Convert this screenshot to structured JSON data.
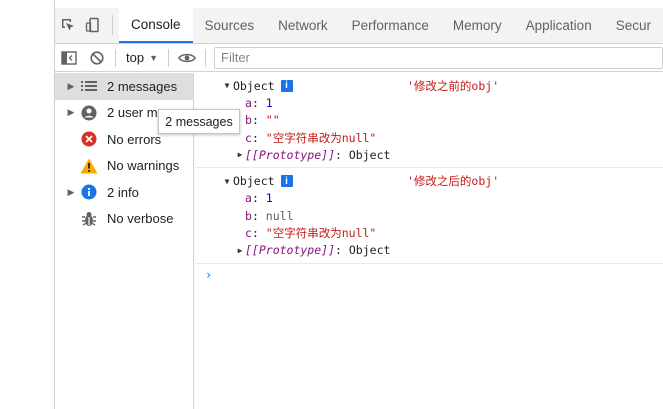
{
  "tabs": [
    {
      "label": "Console",
      "active": true
    },
    {
      "label": "Sources"
    },
    {
      "label": "Network"
    },
    {
      "label": "Performance"
    },
    {
      "label": "Memory"
    },
    {
      "label": "Application"
    },
    {
      "label": "Secur"
    }
  ],
  "toolbar": {
    "context": "top",
    "filter_placeholder": "Filter"
  },
  "sidebar": {
    "items": [
      {
        "label": "2 messages",
        "icon": "list-icon",
        "expandable": true,
        "selected": true
      },
      {
        "label": "2 user m",
        "icon": "user-icon",
        "expandable": true
      },
      {
        "label": "No errors",
        "icon": "error-icon",
        "expandable": false
      },
      {
        "label": "No warnings",
        "icon": "warning-icon",
        "expandable": false
      },
      {
        "label": "2 info",
        "icon": "info-icon",
        "expandable": true
      },
      {
        "label": "No verbose",
        "icon": "bug-icon",
        "expandable": false
      }
    ]
  },
  "tooltip": "2 messages",
  "messages": [
    {
      "object_label": "Object",
      "info_glyph": "i",
      "log_label": "'修改之前的obj'",
      "props": [
        {
          "key": "a",
          "value": "1",
          "type": "num"
        },
        {
          "key": "b",
          "value": "\"\"",
          "type": "str"
        },
        {
          "key": "c",
          "value": "\"空字符串改为null\"",
          "type": "str"
        }
      ],
      "prototype_key": "[[Prototype]]",
      "prototype_value": "Object"
    },
    {
      "object_label": "Object",
      "info_glyph": "i",
      "log_label": "'修改之后的obj'",
      "props": [
        {
          "key": "a",
          "value": "1",
          "type": "num"
        },
        {
          "key": "b",
          "value": "null",
          "type": "nul"
        },
        {
          "key": "c",
          "value": "\"空字符串改为null\"",
          "type": "str"
        }
      ],
      "prototype_key": "[[Prototype]]",
      "prototype_value": "Object"
    }
  ],
  "prompt_glyph": "›",
  "colors": {
    "accent": "#1a73e8",
    "error": "#d93025",
    "warning": "#f9ab00",
    "string": "#c41a16",
    "key": "#881280",
    "number": "#1c00cf"
  }
}
